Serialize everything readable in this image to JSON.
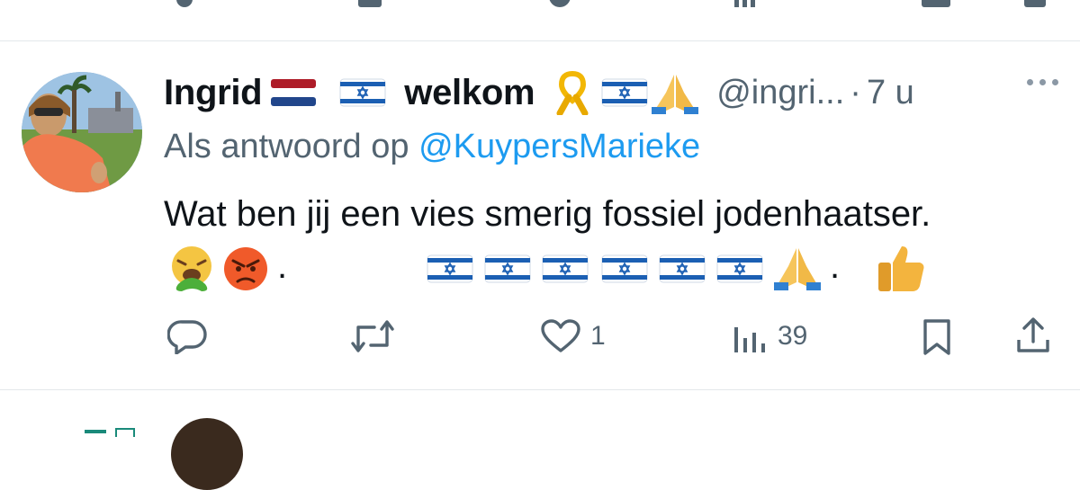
{
  "tweet": {
    "display_name": "Ingrid",
    "display_name_word": "welkom",
    "handle": "@ingri...",
    "separator": "·",
    "time": "7 u",
    "reply_label": "Als antwoord op ",
    "reply_mention": "@KuypersMarieke",
    "text": "Wat ben jij een vies smerig fossiel jodenhaatser.",
    "emoji_dot_1": ".",
    "emoji_dot_2": "."
  },
  "actions": {
    "reply_count": "",
    "retweet_count": "",
    "like_count": "1",
    "views_count": "39"
  },
  "icons": {
    "reply": "reply-icon",
    "retweet": "retweet-icon",
    "like": "heart-icon",
    "views": "views-icon",
    "bookmark": "bookmark-icon",
    "share": "share-icon",
    "more": "more-icon"
  },
  "colors": {
    "text": "#0f1419",
    "secondary": "#536471",
    "link": "#1d9bf0",
    "divider": "#e4e8eb"
  }
}
